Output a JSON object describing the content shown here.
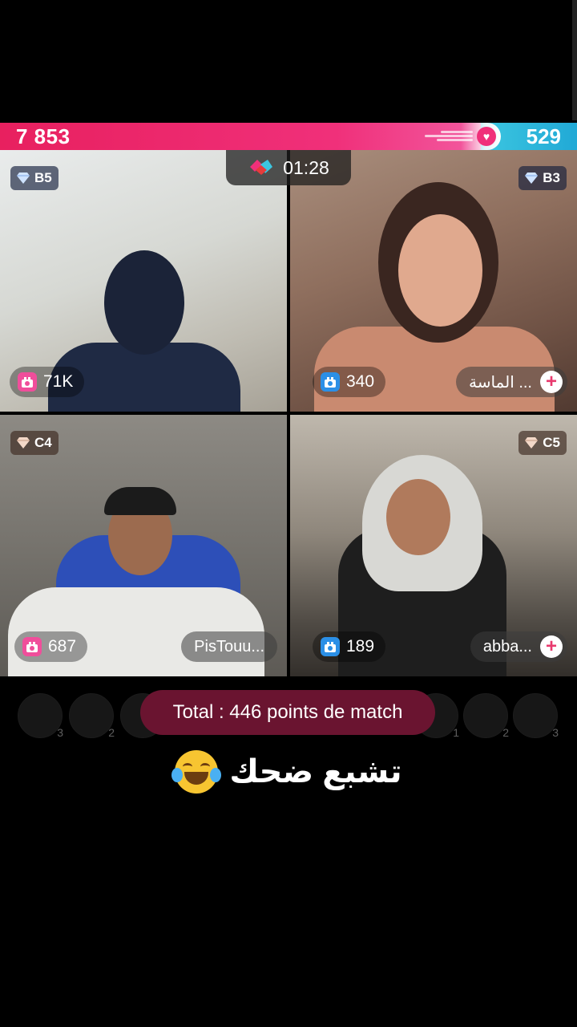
{
  "battle": {
    "score_left": "7 853",
    "score_right": "529",
    "timer": "01:28",
    "colors": {
      "left": "#e8205f",
      "right": "#3cc6e0"
    }
  },
  "tiles": [
    {
      "rank": "B5",
      "rank_icon": "diamond-icon",
      "points": "71K",
      "points_icon": "gift-pink-icon",
      "name": ""
    },
    {
      "rank": "B3",
      "rank_icon": "diamond-icon",
      "points": "340",
      "points_icon": "gift-blue-icon",
      "name": "الماسة ..."
    },
    {
      "rank": "C4",
      "rank_icon": "diamond-icon",
      "points": "687",
      "points_icon": "gift-pink-icon",
      "name": "PisTouu..."
    },
    {
      "rank": "C5",
      "rank_icon": "diamond-icon",
      "points": "189",
      "points_icon": "gift-blue-icon",
      "name": "abba..."
    }
  ],
  "bottom": {
    "total": "Total : 446 points de match",
    "avatar_numbers": [
      "3",
      "2",
      "",
      "1",
      "2",
      "3"
    ]
  },
  "caption": {
    "text": "تشبع ضحك",
    "emoji": "laughing-tears-emoji"
  }
}
